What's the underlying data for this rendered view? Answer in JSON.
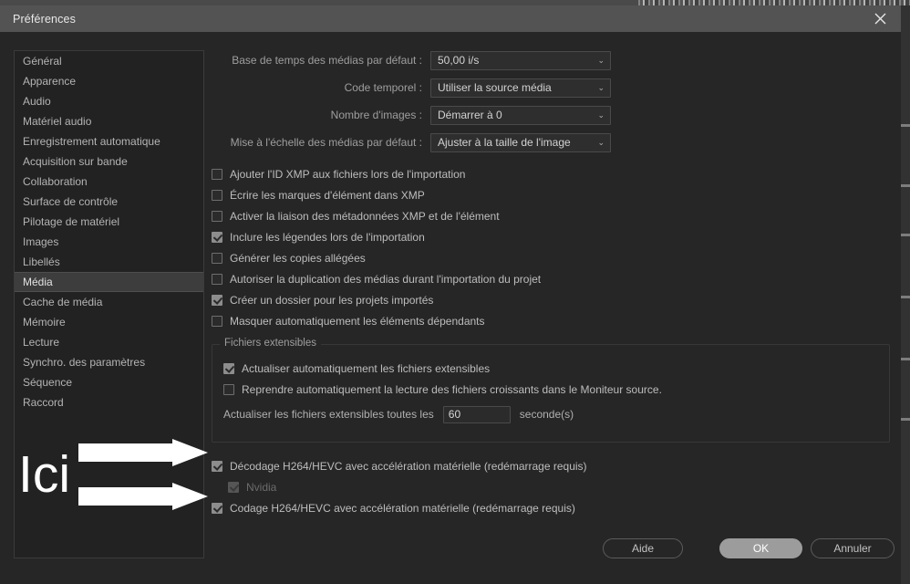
{
  "window": {
    "title": "Préférences",
    "close_icon": "close-icon"
  },
  "sidebar": {
    "items": [
      {
        "label": "Général",
        "selected": false
      },
      {
        "label": "Apparence",
        "selected": false
      },
      {
        "label": "Audio",
        "selected": false
      },
      {
        "label": "Matériel audio",
        "selected": false
      },
      {
        "label": "Enregistrement automatique",
        "selected": false
      },
      {
        "label": "Acquisition sur bande",
        "selected": false
      },
      {
        "label": "Collaboration",
        "selected": false
      },
      {
        "label": "Surface de contrôle",
        "selected": false
      },
      {
        "label": "Pilotage de matériel",
        "selected": false
      },
      {
        "label": "Images",
        "selected": false
      },
      {
        "label": "Libellés",
        "selected": false
      },
      {
        "label": "Média",
        "selected": true
      },
      {
        "label": "Cache de média",
        "selected": false
      },
      {
        "label": "Mémoire",
        "selected": false
      },
      {
        "label": "Lecture",
        "selected": false
      },
      {
        "label": "Synchro. des paramètres",
        "selected": false
      },
      {
        "label": "Séquence",
        "selected": false
      },
      {
        "label": "Raccord",
        "selected": false
      }
    ]
  },
  "settings": {
    "dropdowns": [
      {
        "label": "Base de temps des médias par défaut :",
        "value": "50,00  i/s"
      },
      {
        "label": "Code temporel :",
        "value": "Utiliser la source média"
      },
      {
        "label": "Nombre d'images :",
        "value": "Démarrer à 0"
      },
      {
        "label": "Mise à l'échelle des médias par défaut :",
        "value": "Ajuster à la taille de l'image"
      }
    ],
    "checkboxes": [
      {
        "label": "Ajouter l'ID XMP aux fichiers lors de l'importation",
        "checked": false
      },
      {
        "label": "Écrire les marques d'élément dans XMP",
        "checked": false
      },
      {
        "label": "Activer la liaison des métadonnées XMP et de l'élément",
        "checked": false
      },
      {
        "label": "Inclure les légendes lors de l'importation",
        "checked": true
      },
      {
        "label": "Générer les copies allégées",
        "checked": false
      },
      {
        "label": "Autoriser la duplication des médias durant l'importation du projet",
        "checked": false
      },
      {
        "label": "Créer un dossier pour les projets importés",
        "checked": true
      },
      {
        "label": "Masquer automatiquement les éléments dépendants",
        "checked": false
      }
    ],
    "growing_files": {
      "legend": "Fichiers extensibles",
      "checkboxes": [
        {
          "label": "Actualiser automatiquement les fichiers extensibles",
          "checked": true
        },
        {
          "label": "Reprendre automatiquement la lecture des fichiers croissants dans le Moniteur source.",
          "checked": false
        }
      ],
      "interval_label": "Actualiser les fichiers extensibles toutes les",
      "interval_value": "60",
      "interval_placeholder": "60",
      "interval_unit": "seconde(s)"
    },
    "hardware_acceleration": [
      {
        "label": "Décodage H264/HEVC avec accélération matérielle (redémarrage requis)",
        "checked": true,
        "disabled": false,
        "indent": false
      },
      {
        "label": "Nvidia",
        "checked": true,
        "disabled": true,
        "indent": true
      },
      {
        "label": "Codage H264/HEVC avec accélération matérielle (redémarrage requis)",
        "checked": true,
        "disabled": false,
        "indent": false
      }
    ]
  },
  "footer": {
    "help_label": "Aide",
    "ok_label": "OK",
    "cancel_label": "Annuler"
  },
  "annotation": {
    "text": "Ici",
    "arrow_icon": "right-arrow-icon",
    "color": "#ffffff"
  }
}
